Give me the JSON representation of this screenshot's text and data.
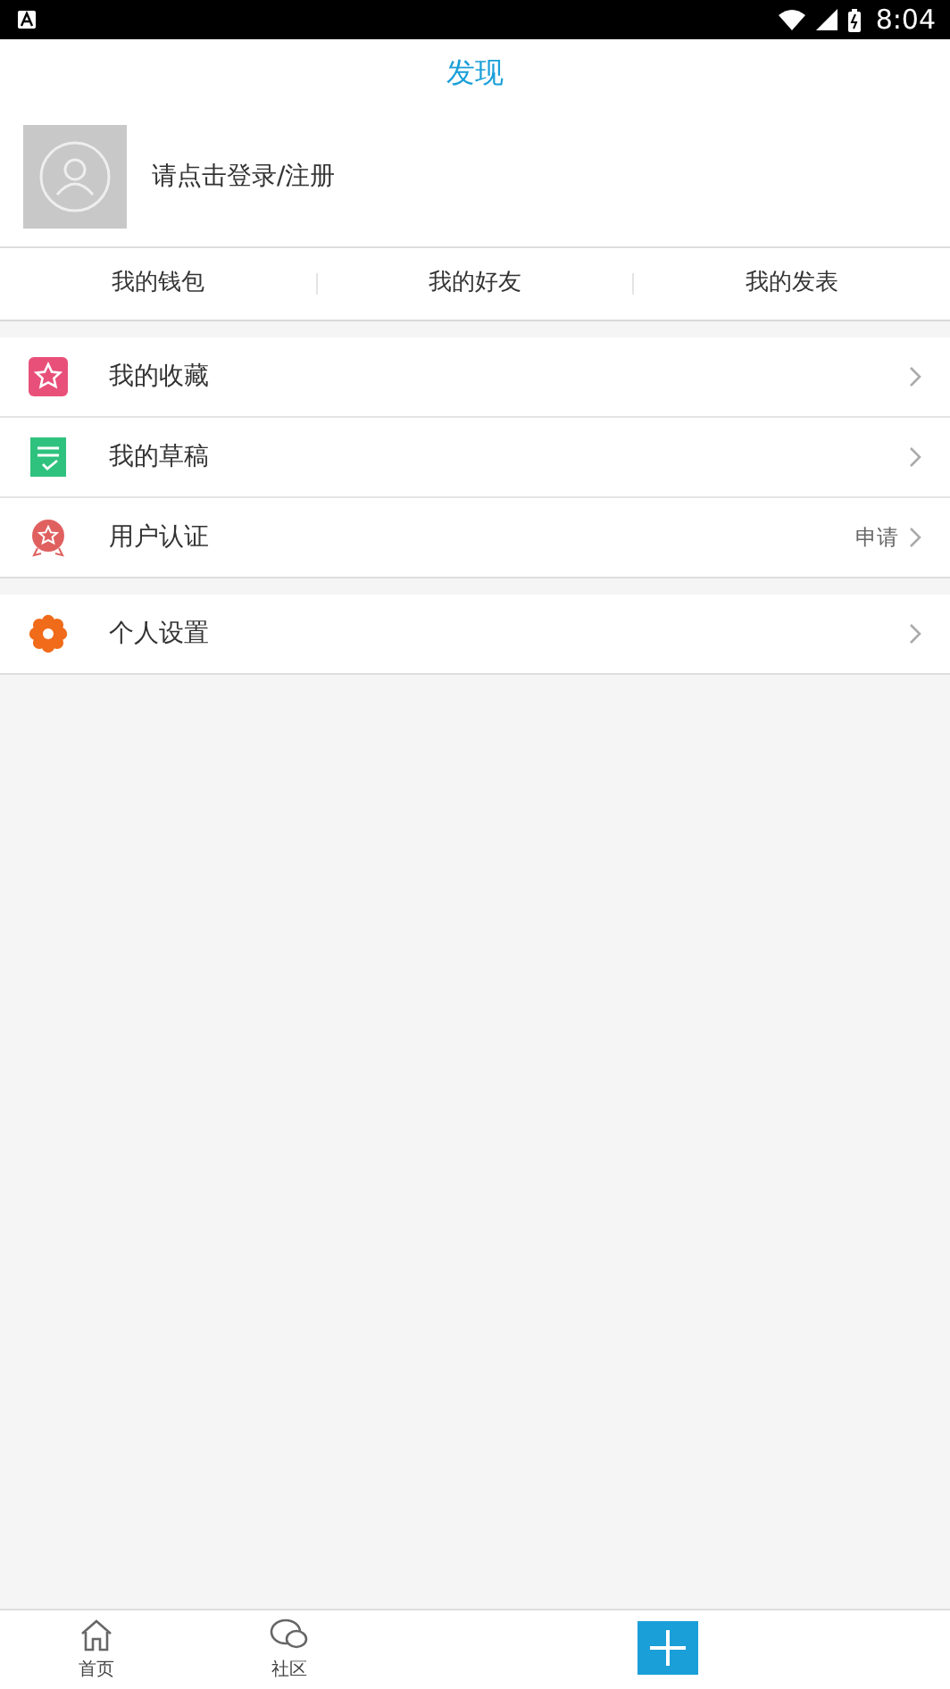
{
  "status_bar": {
    "time": "8:04"
  },
  "header": {
    "title": "发现"
  },
  "profile": {
    "prompt": "请点击登录/注册"
  },
  "quick_links": [
    "我的钱包",
    "我的好友",
    "我的发表"
  ],
  "menu_groups": [
    {
      "items": [
        {
          "kind": "star",
          "label": "我的收藏"
        },
        {
          "kind": "note",
          "label": "我的草稿"
        },
        {
          "kind": "badge",
          "label": "用户认证",
          "detail": "申请"
        }
      ]
    },
    {
      "items": [
        {
          "kind": "gear",
          "label": "个人设置"
        }
      ]
    }
  ],
  "tab_bar": [
    {
      "kind": "home",
      "label": "首页"
    },
    {
      "kind": "chat",
      "label": "社区"
    },
    {
      "kind": "add"
    }
  ]
}
